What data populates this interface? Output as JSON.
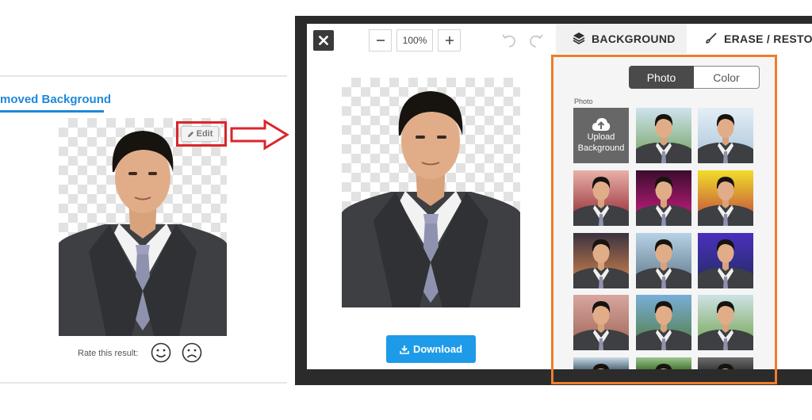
{
  "card": {
    "heading": "moved Background",
    "edit_label": "Edit",
    "rate_label": "Rate this result:"
  },
  "modal": {
    "zoom_level": "100%",
    "tabs": [
      {
        "label": "BACKGROUND",
        "active": true
      },
      {
        "label": "ERASE / RESTORE",
        "active": false
      }
    ],
    "download_label": "Download",
    "panel": {
      "segments": [
        {
          "label": "Photo",
          "selected": true
        },
        {
          "label": "Color",
          "selected": false
        }
      ],
      "section_label": "Photo",
      "upload_tile": {
        "line1": "Upload",
        "line2": "Background"
      },
      "backgrounds": [
        {
          "top": "#cfe3ee",
          "bottom": "#6f9e58"
        },
        {
          "top": "#e4eef6",
          "bottom": "#a7c3d8"
        },
        {
          "top": "#e8b1a8",
          "bottom": "#8d1e2c"
        },
        {
          "top": "#3b0c2d",
          "bottom": "#d81f8b"
        },
        {
          "top": "#f0de2a",
          "bottom": "#bf3a3f"
        },
        {
          "top": "#3a3240",
          "bottom": "#e08a4e"
        },
        {
          "top": "#b6d2e4",
          "bottom": "#5c7386"
        },
        {
          "top": "#4b2fbd",
          "bottom": "#1e2e5e"
        },
        {
          "top": "#d7a7a0",
          "bottom": "#9c6150"
        },
        {
          "top": "#7aaed8",
          "bottom": "#4e7a3a"
        },
        {
          "top": "#cde2e6",
          "bottom": "#6ea144"
        },
        {
          "top": "#c9d9e6",
          "bottom": "#556d7e"
        },
        {
          "top": "#9cc58e",
          "bottom": "#4a7b3a"
        },
        {
          "top": "#6d6d6d",
          "bottom": "#3c3c3c"
        }
      ]
    }
  },
  "colors": {
    "accent_blue": "#1e88d8",
    "download_blue": "#1e9be8",
    "highlight_red": "#d9262c",
    "highlight_orange": "#ef7d2a",
    "modal_dark": "#2b2b2b"
  }
}
